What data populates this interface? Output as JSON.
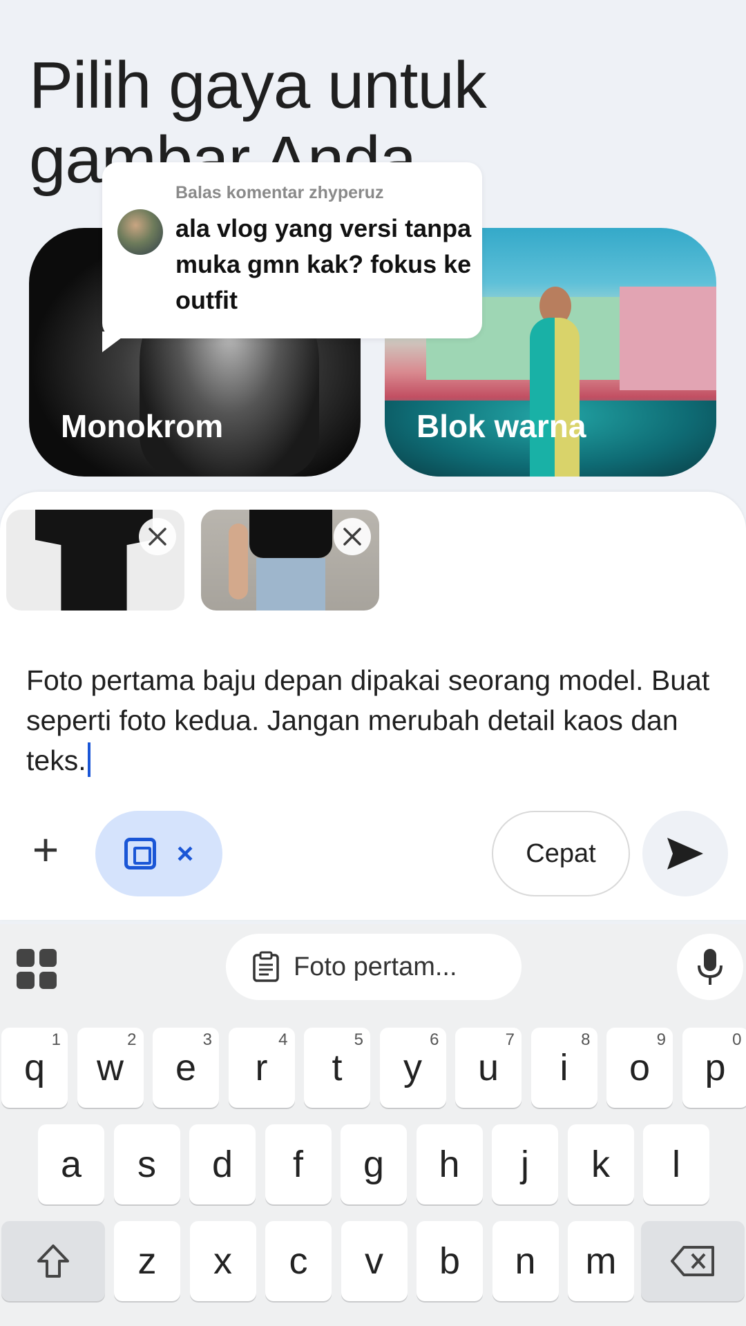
{
  "page": {
    "title": "Pilih gaya untuk gambar Anda"
  },
  "styles": [
    {
      "label": "Monokrom"
    },
    {
      "label": "Blok warna"
    }
  ],
  "comment": {
    "reply_to": "Balas komentar zhyperuz",
    "text": "ala vlog yang versi tanpa muka gmn kak? fokus ke outfit"
  },
  "composer": {
    "attachments": [
      {
        "name": "black-tshirt-photo"
      },
      {
        "name": "model-reference-photo"
      }
    ],
    "prompt_text": "Foto pertama baju depan dipakai seorang model. Buat seperti foto kedua. Jangan merubah detail kaos dan teks.",
    "tool_chip_close": "×",
    "speed_label": "Cepat"
  },
  "keyboard": {
    "clipboard_suggestion": "Foto pertam...",
    "row1": [
      {
        "k": "q",
        "h": "1"
      },
      {
        "k": "w",
        "h": "2"
      },
      {
        "k": "e",
        "h": "3"
      },
      {
        "k": "r",
        "h": "4"
      },
      {
        "k": "t",
        "h": "5"
      },
      {
        "k": "y",
        "h": "6"
      },
      {
        "k": "u",
        "h": "7"
      },
      {
        "k": "i",
        "h": "8"
      },
      {
        "k": "o",
        "h": "9"
      },
      {
        "k": "p",
        "h": "0"
      }
    ],
    "row2": [
      "a",
      "s",
      "d",
      "f",
      "g",
      "h",
      "j",
      "k",
      "l"
    ],
    "row3": [
      "z",
      "x",
      "c",
      "v",
      "b",
      "n",
      "m"
    ]
  }
}
